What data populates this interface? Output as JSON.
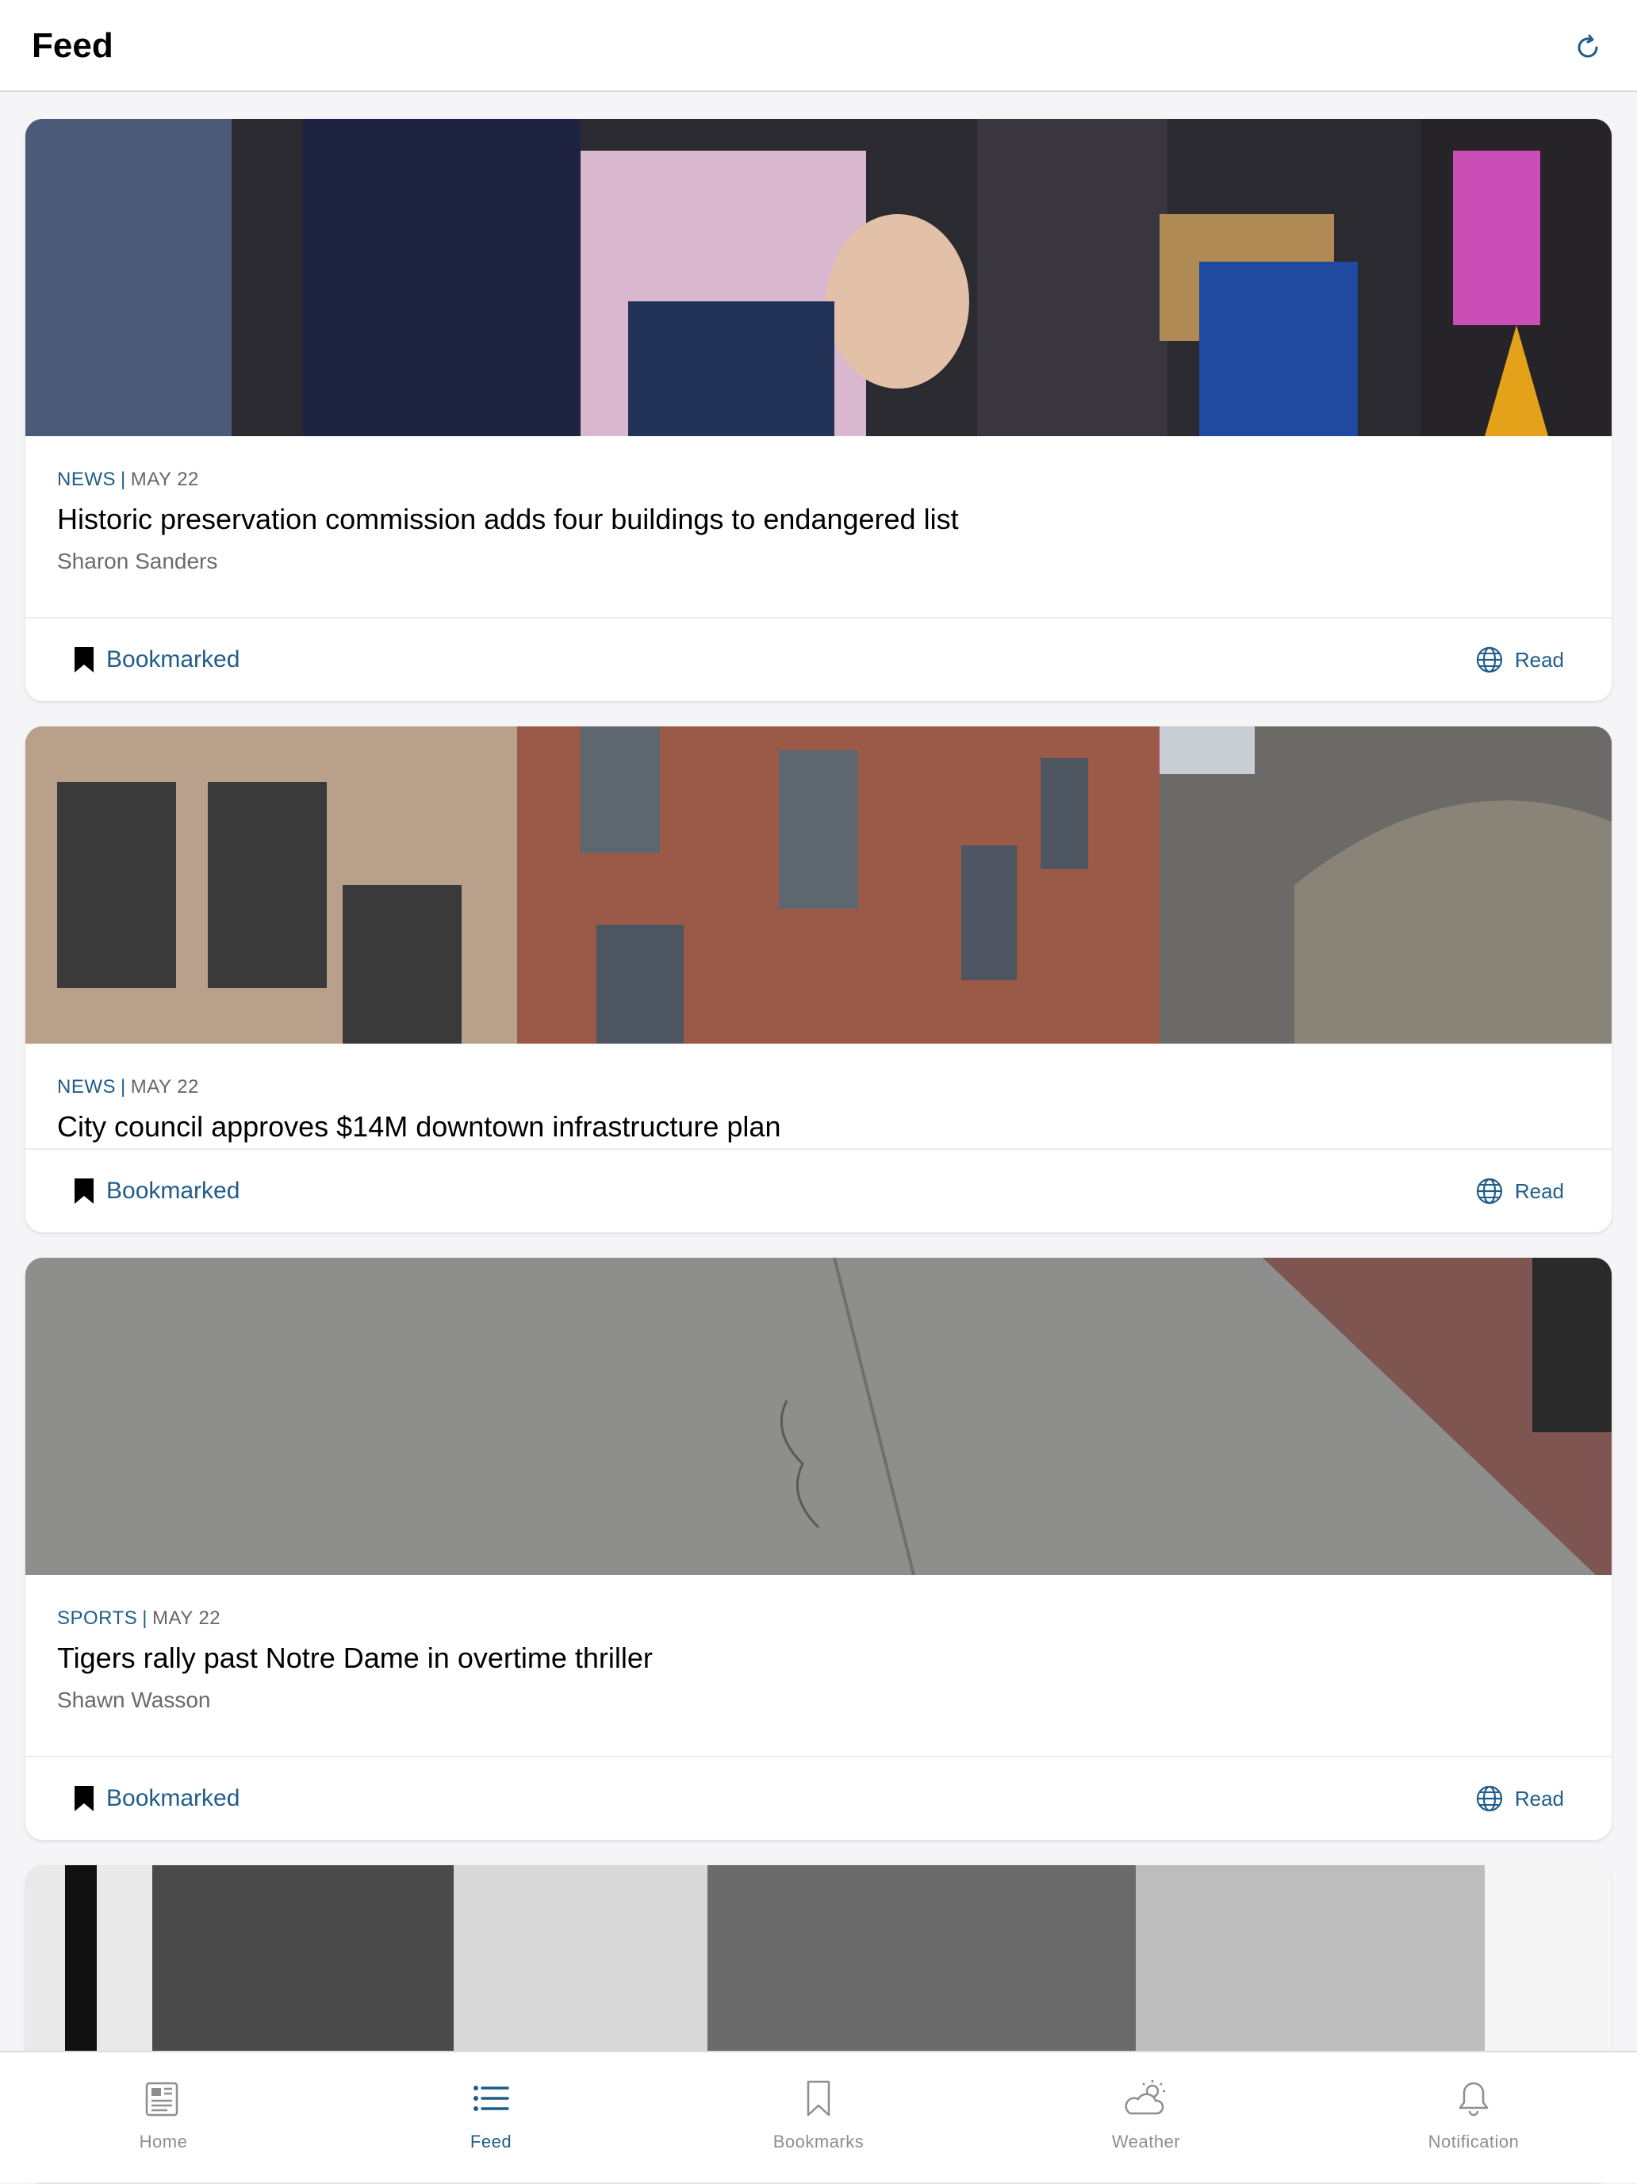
{
  "header": {
    "title": "Feed"
  },
  "articles": [
    {
      "category": "NEWS",
      "separator": "|",
      "date": "MAY 22",
      "headline": "Historic preservation commission adds four buildings to endangered list",
      "author": "Sharon Sanders",
      "bookmark_label": "Bookmarked",
      "read_label": "Read"
    },
    {
      "category": "NEWS",
      "separator": "|",
      "date": "MAY 22",
      "headline": "City council approves $14M downtown infrastructure plan",
      "author": "",
      "bookmark_label": "Bookmarked",
      "read_label": "Read"
    },
    {
      "category": "SPORTS",
      "separator": "|",
      "date": "MAY 22",
      "headline": "Tigers rally past Notre Dame in overtime thriller",
      "author": "Shawn Wasson",
      "bookmark_label": "Bookmarked",
      "read_label": "Read"
    }
  ],
  "tabbar": {
    "items": [
      {
        "label": "Home",
        "icon": "newspaper-icon",
        "active": false
      },
      {
        "label": "Feed",
        "icon": "list-icon",
        "active": true
      },
      {
        "label": "Bookmarks",
        "icon": "bookmark-icon",
        "active": false
      },
      {
        "label": "Weather",
        "icon": "cloud-sun-icon",
        "active": false
      },
      {
        "label": "Notification",
        "icon": "bell-icon",
        "active": false
      }
    ]
  },
  "colors": {
    "accent": "#1f5c8a",
    "inactive": "#8e8e8e",
    "background": "#f5f5f7"
  }
}
